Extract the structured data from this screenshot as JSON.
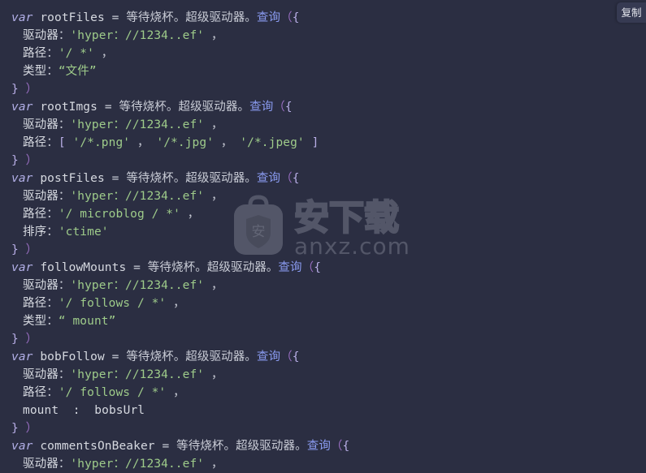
{
  "window": {
    "background_color": "#2b2e42",
    "type": "code-snippet-viewer"
  },
  "toolbar": {
    "copy_label": "复制",
    "copy_icon": "copy-icon"
  },
  "watermark": {
    "site_name": "安下载",
    "domain": "anxz.com",
    "logo_glyph": "安",
    "logo_icon": "shield-bag-icon",
    "color": "#8b8f9e"
  },
  "palette": {
    "keyword": "#b3b0e8",
    "identifier": "#d6d9e0",
    "function": "#8a9bf0",
    "paren": "#9b6fc4",
    "brace": "#b8aee6",
    "string": "#9ecb8a",
    "punctuation": "#c9ccd6",
    "prose": "#c9ccd6"
  },
  "code": {
    "language": "javascript",
    "lines": [
      {
        "indent": 0,
        "tokens": [
          {
            "t": "kw",
            "v": "var"
          },
          {
            "t": "plain",
            "v": " rootFiles "
          },
          {
            "t": "punct",
            "v": "= "
          },
          {
            "t": "dim",
            "v": "等待烧杯。超级驱动器。"
          },
          {
            "t": "fn",
            "v": "查询"
          },
          {
            "t": "paren",
            "v": "（"
          },
          {
            "t": "brace",
            "v": "{"
          }
        ]
      },
      {
        "indent": 1,
        "tokens": [
          {
            "t": "plain",
            "v": "驱动器"
          },
          {
            "t": "punct",
            "v": "："
          },
          {
            "t": "str",
            "v": "'hyper：//1234..ef'"
          },
          {
            "t": "punct",
            "v": " ，"
          }
        ]
      },
      {
        "indent": 1,
        "tokens": [
          {
            "t": "plain",
            "v": "路径"
          },
          {
            "t": "punct",
            "v": "："
          },
          {
            "t": "str",
            "v": "'/ *'"
          },
          {
            "t": "punct",
            "v": " ，"
          }
        ]
      },
      {
        "indent": 1,
        "tokens": [
          {
            "t": "plain",
            "v": "类型"
          },
          {
            "t": "punct",
            "v": "："
          },
          {
            "t": "str",
            "v": "“文件”"
          }
        ]
      },
      {
        "indent": 0,
        "tokens": [
          {
            "t": "brace",
            "v": "}"
          },
          {
            "t": "paren",
            "v": " ）"
          }
        ]
      },
      {
        "indent": 0,
        "tokens": [
          {
            "t": "kw",
            "v": "var"
          },
          {
            "t": "plain",
            "v": " rootImgs "
          },
          {
            "t": "punct",
            "v": "= "
          },
          {
            "t": "dim",
            "v": "等待烧杯。超级驱动器。"
          },
          {
            "t": "fn",
            "v": "查询"
          },
          {
            "t": "paren",
            "v": "（"
          },
          {
            "t": "brace",
            "v": "{"
          }
        ]
      },
      {
        "indent": 1,
        "tokens": [
          {
            "t": "plain",
            "v": "驱动器"
          },
          {
            "t": "punct",
            "v": "："
          },
          {
            "t": "str",
            "v": "'hyper：//1234..ef'"
          },
          {
            "t": "punct",
            "v": " ，"
          }
        ]
      },
      {
        "indent": 1,
        "tokens": [
          {
            "t": "plain",
            "v": "路径"
          },
          {
            "t": "punct",
            "v": "："
          },
          {
            "t": "brace",
            "v": "[ "
          },
          {
            "t": "str",
            "v": "'/*.png'"
          },
          {
            "t": "punct",
            "v": " ，"
          },
          {
            "t": "str",
            "v": " '/*.jpg'"
          },
          {
            "t": "punct",
            "v": " ，"
          },
          {
            "t": "str",
            "v": " '/*.jpeg'"
          },
          {
            "t": "brace",
            "v": " ]"
          }
        ]
      },
      {
        "indent": 0,
        "tokens": [
          {
            "t": "brace",
            "v": "}"
          },
          {
            "t": "paren",
            "v": " ）"
          }
        ]
      },
      {
        "indent": 0,
        "tokens": [
          {
            "t": "kw",
            "v": "var"
          },
          {
            "t": "plain",
            "v": " postFiles "
          },
          {
            "t": "punct",
            "v": "= "
          },
          {
            "t": "dim",
            "v": "等待烧杯。超级驱动器。"
          },
          {
            "t": "fn",
            "v": "查询"
          },
          {
            "t": "paren",
            "v": "（"
          },
          {
            "t": "brace",
            "v": "{"
          }
        ]
      },
      {
        "indent": 1,
        "tokens": [
          {
            "t": "plain",
            "v": "驱动器"
          },
          {
            "t": "punct",
            "v": "："
          },
          {
            "t": "str",
            "v": "'hyper：//1234..ef'"
          },
          {
            "t": "punct",
            "v": " ，"
          }
        ]
      },
      {
        "indent": 1,
        "tokens": [
          {
            "t": "plain",
            "v": "路径"
          },
          {
            "t": "punct",
            "v": "："
          },
          {
            "t": "str",
            "v": "'/ microblog / *'"
          },
          {
            "t": "punct",
            "v": " ，"
          }
        ]
      },
      {
        "indent": 1,
        "tokens": [
          {
            "t": "plain",
            "v": "排序"
          },
          {
            "t": "punct",
            "v": "："
          },
          {
            "t": "str",
            "v": "'ctime'"
          }
        ]
      },
      {
        "indent": 0,
        "tokens": [
          {
            "t": "brace",
            "v": "}"
          },
          {
            "t": "paren",
            "v": " ）"
          }
        ]
      },
      {
        "indent": 0,
        "tokens": [
          {
            "t": "kw",
            "v": "var"
          },
          {
            "t": "plain",
            "v": " followMounts "
          },
          {
            "t": "punct",
            "v": "= "
          },
          {
            "t": "dim",
            "v": "等待烧杯。超级驱动器。"
          },
          {
            "t": "fn",
            "v": "查询"
          },
          {
            "t": "paren",
            "v": "（"
          },
          {
            "t": "brace",
            "v": "{"
          }
        ]
      },
      {
        "indent": 1,
        "tokens": [
          {
            "t": "plain",
            "v": "驱动器"
          },
          {
            "t": "punct",
            "v": "："
          },
          {
            "t": "str",
            "v": "'hyper：//1234..ef'"
          },
          {
            "t": "punct",
            "v": " ，"
          }
        ]
      },
      {
        "indent": 1,
        "tokens": [
          {
            "t": "plain",
            "v": "路径"
          },
          {
            "t": "punct",
            "v": "："
          },
          {
            "t": "str",
            "v": "'/ follows / *'"
          },
          {
            "t": "punct",
            "v": " ，"
          }
        ]
      },
      {
        "indent": 1,
        "tokens": [
          {
            "t": "plain",
            "v": "类型"
          },
          {
            "t": "punct",
            "v": "："
          },
          {
            "t": "str",
            "v": "“ mount”"
          }
        ]
      },
      {
        "indent": 0,
        "tokens": [
          {
            "t": "brace",
            "v": "}"
          },
          {
            "t": "paren",
            "v": " ）"
          }
        ]
      },
      {
        "indent": 0,
        "tokens": [
          {
            "t": "kw",
            "v": "var"
          },
          {
            "t": "plain",
            "v": " bobFollow "
          },
          {
            "t": "punct",
            "v": "= "
          },
          {
            "t": "dim",
            "v": "等待烧杯。超级驱动器。"
          },
          {
            "t": "fn",
            "v": "查询"
          },
          {
            "t": "paren",
            "v": "（"
          },
          {
            "t": "brace",
            "v": "{"
          }
        ]
      },
      {
        "indent": 1,
        "tokens": [
          {
            "t": "plain",
            "v": "驱动器"
          },
          {
            "t": "punct",
            "v": "："
          },
          {
            "t": "str",
            "v": "'hyper：//1234..ef'"
          },
          {
            "t": "punct",
            "v": " ，"
          }
        ]
      },
      {
        "indent": 1,
        "tokens": [
          {
            "t": "plain",
            "v": "路径"
          },
          {
            "t": "punct",
            "v": "："
          },
          {
            "t": "str",
            "v": "'/ follows / *'"
          },
          {
            "t": "punct",
            "v": " ，"
          }
        ]
      },
      {
        "indent": 1,
        "tokens": [
          {
            "t": "plain",
            "v": "mount  :  bobsUrl"
          }
        ]
      },
      {
        "indent": 0,
        "tokens": [
          {
            "t": "brace",
            "v": "}"
          },
          {
            "t": "paren",
            "v": " ）"
          }
        ]
      },
      {
        "indent": 0,
        "tokens": [
          {
            "t": "kw",
            "v": "var"
          },
          {
            "t": "plain",
            "v": " commentsOnBeaker "
          },
          {
            "t": "punct",
            "v": "= "
          },
          {
            "t": "dim",
            "v": "等待烧杯。超级驱动器。"
          },
          {
            "t": "fn",
            "v": "查询"
          },
          {
            "t": "paren",
            "v": "（"
          },
          {
            "t": "brace",
            "v": "{"
          }
        ]
      },
      {
        "indent": 1,
        "tokens": [
          {
            "t": "plain",
            "v": "驱动器"
          },
          {
            "t": "punct",
            "v": "："
          },
          {
            "t": "str",
            "v": "'hyper：//1234..ef'"
          },
          {
            "t": "punct",
            "v": " ，"
          }
        ]
      }
    ]
  }
}
